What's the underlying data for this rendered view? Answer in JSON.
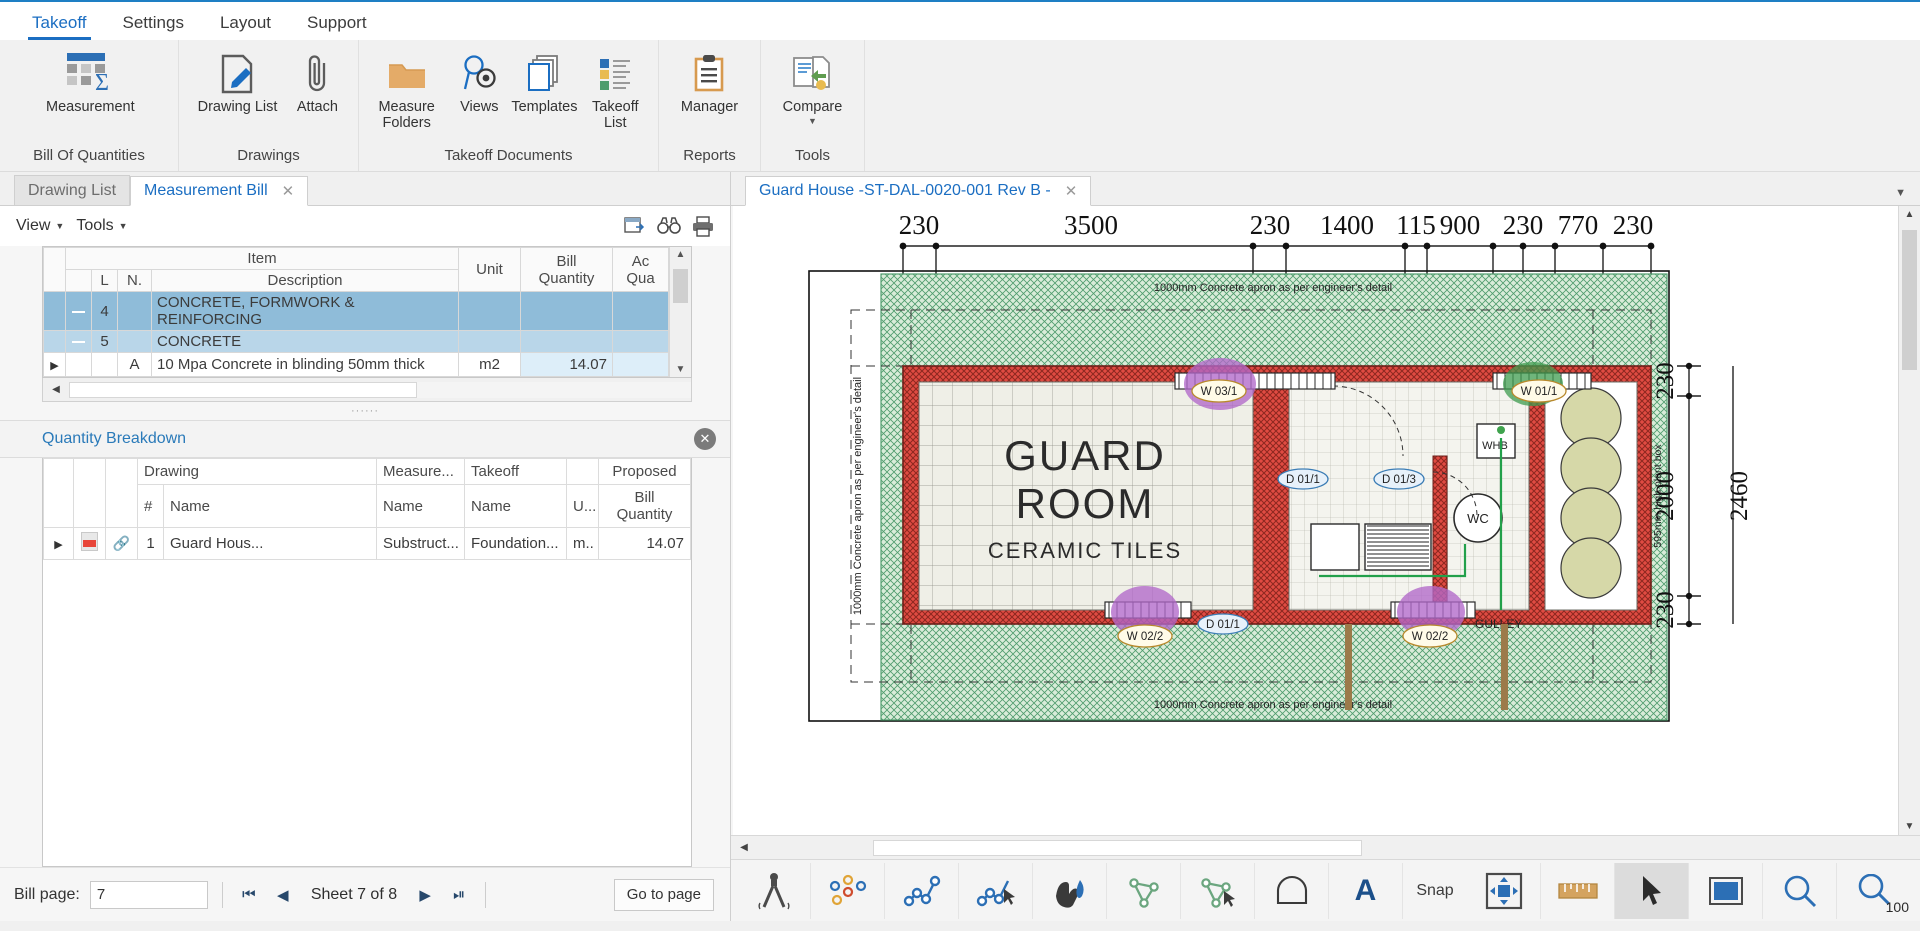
{
  "ribbon": {
    "tabs": [
      {
        "label": "Takeoff",
        "active": true
      },
      {
        "label": "Settings",
        "active": false
      },
      {
        "label": "Layout",
        "active": false
      },
      {
        "label": "Support",
        "active": false
      }
    ],
    "groups": [
      {
        "title": "Bill Of Quantities",
        "buttons": [
          {
            "label": "Measurement",
            "icon": "measurement-grid-icon"
          }
        ]
      },
      {
        "title": "Drawings",
        "buttons": [
          {
            "label": "Drawing List",
            "icon": "drawing-list-icon"
          },
          {
            "label": "Attach",
            "icon": "paperclip-icon"
          }
        ]
      },
      {
        "title": "Takeoff Documents",
        "buttons": [
          {
            "label": "Measure Folders",
            "icon": "folder-icon"
          },
          {
            "label": "Views",
            "icon": "views-magnifier-icon"
          },
          {
            "label": "Templates",
            "icon": "templates-stack-icon"
          },
          {
            "label": "Takeoff List",
            "icon": "takeoff-list-icon"
          }
        ]
      },
      {
        "title": "Reports",
        "buttons": [
          {
            "label": "Manager",
            "icon": "clipboard-icon"
          }
        ]
      },
      {
        "title": "Tools",
        "buttons": [
          {
            "label": "Compare",
            "icon": "compare-docs-icon",
            "has_caret": true
          }
        ]
      }
    ]
  },
  "left_panel": {
    "tabs": [
      {
        "label": "Drawing List",
        "active": false,
        "closable": false
      },
      {
        "label": "Measurement Bill",
        "active": true,
        "closable": true
      }
    ],
    "toolbar": {
      "menus": [
        {
          "label": "View"
        },
        {
          "label": "Tools"
        }
      ],
      "icons": [
        "export-grid-icon",
        "binoculars-icon",
        "print-icon"
      ]
    },
    "bill_grid": {
      "group_header": "Item",
      "columns": [
        "L",
        "N.",
        "Description",
        "Unit",
        "Bill Quantity",
        "Ac Qua"
      ],
      "rows": [
        {
          "expander": "minus",
          "L": "4",
          "N": "",
          "description": "CONCRETE, FORMWORK & REINFORCING",
          "unit": "",
          "bill_quantity": "",
          "ac_quantity": "",
          "style": "group1"
        },
        {
          "expander": "minus",
          "L": "5",
          "N": "",
          "description": "CONCRETE",
          "unit": "",
          "bill_quantity": "",
          "ac_quantity": "",
          "style": "group2"
        },
        {
          "expander": "arrow",
          "L": "",
          "N": "A",
          "description": "10 Mpa Concrete in blinding 50mm thick",
          "unit": "m2",
          "bill_quantity": "14.07",
          "ac_quantity": "",
          "style": "plain"
        }
      ]
    },
    "quantity_breakdown": {
      "title": "Quantity Breakdown",
      "close_label": "✕",
      "group_headers": [
        "Drawing",
        "Measure...",
        "Takeoff",
        "",
        "Proposed"
      ],
      "columns": [
        "#",
        "Name",
        "Name",
        "Name",
        "U...",
        "Bill Quantity"
      ],
      "rows": [
        {
          "num": "1",
          "drawing_name": "Guard Hous...",
          "measure_name": "Substruct...",
          "takeoff_name": "Foundation...",
          "unit": "m..",
          "bill_quantity": "14.07"
        }
      ]
    },
    "page_bar": {
      "bill_page_label": "Bill page:",
      "bill_page_value": "7",
      "sheet_label": "Sheet 7 of 8",
      "go_to_page_label": "Go to page",
      "first_icon": "first-page-icon",
      "prev_icon": "prev-page-icon",
      "next_icon": "next-page-icon",
      "last_icon": "last-page-icon"
    }
  },
  "drawing_panel": {
    "tab": {
      "label": "Guard House -ST-DAL-0020-001 Rev B -",
      "closable": true
    },
    "tabs_caret": "▼",
    "tools": [
      {
        "name": "compass-tool",
        "label": ""
      },
      {
        "name": "points-tool",
        "label": ""
      },
      {
        "name": "polyline-tool",
        "label": ""
      },
      {
        "name": "polyline-select-tool",
        "label": ""
      },
      {
        "name": "hand-paint-tool",
        "label": ""
      },
      {
        "name": "polygon-tool",
        "label": ""
      },
      {
        "name": "polygon-select-tool",
        "label": ""
      },
      {
        "name": "arch-tool",
        "label": ""
      },
      {
        "name": "text-tool",
        "label": "A"
      },
      {
        "name": "snap-tool",
        "label": "Snap"
      },
      {
        "name": "pan-tool",
        "label": ""
      },
      {
        "name": "ruler-tool",
        "label": ""
      },
      {
        "name": "cursor-tool",
        "label": ""
      },
      {
        "name": "rect-select-tool",
        "label": ""
      },
      {
        "name": "zoom-window-tool",
        "label": ""
      },
      {
        "name": "zoom-100-tool",
        "label": "100"
      }
    ],
    "drawing": {
      "top_dimensions": [
        "230",
        "3500",
        "230",
        "1400",
        "115",
        "900",
        "230",
        "770",
        "230"
      ],
      "right_dimensions": [
        "230",
        "2000",
        "230"
      ],
      "right_overall": "2460",
      "plant_box_note": "595mm high plant box",
      "apron_note_top": "1000mm Concrete apron as per engineer's detail",
      "apron_note_bottom": "1000mm Concrete apron as per engineer's detail",
      "apron_note_left": "1000mm Concrete apron as per engineer's detail",
      "room_label_line1": "GUARD",
      "room_label_line2": "ROOM",
      "room_label_line3": "CERAMIC TILES",
      "wc_label": "WC",
      "whb_label": "WHB",
      "gulley_label": "GULLEY",
      "window_tags": [
        "W 03/1",
        "W 01/1",
        "W 02/2",
        "W 02/2"
      ],
      "door_tags": [
        "D 01/1",
        "D 01/3",
        "D 01/1"
      ]
    }
  }
}
